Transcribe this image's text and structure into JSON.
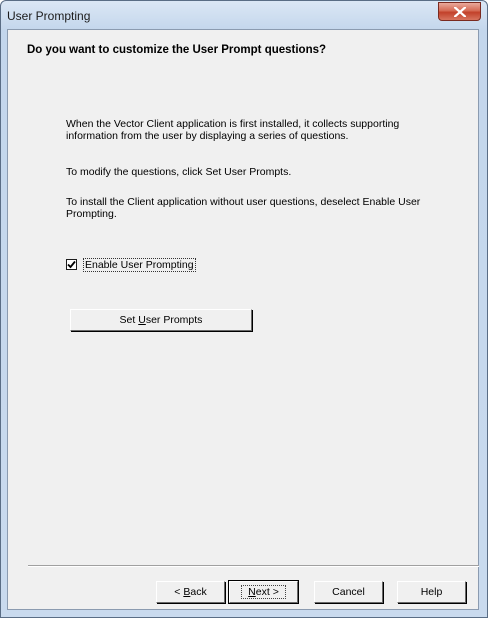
{
  "window": {
    "title": "User Prompting"
  },
  "content": {
    "heading": "Do you want to customize the User Prompt questions?",
    "paragraph1": "When the Vector Client application is first installed, it collects supporting information from the user by displaying a series of questions.",
    "paragraph2": "To modify the questions, click Set User Prompts.",
    "paragraph3": "To install the Client application without user questions, deselect Enable User Prompting.",
    "checkbox": {
      "label": "Enable User Prompting",
      "checked": true
    },
    "set_prompts_button": {
      "label_pre": "Set ",
      "label_accel": "U",
      "label_post": "ser Prompts"
    }
  },
  "footer": {
    "back_button": {
      "pre": "< ",
      "accel": "B",
      "post": "ack"
    },
    "next_button": {
      "pre": "",
      "accel": "N",
      "post": "ext >"
    },
    "cancel_label": "Cancel",
    "help_label": "Help"
  },
  "colors": {
    "title_gradient_top": "#dbe7f5",
    "close_button": "#c2412a",
    "client_bg": "#f0f0f0"
  },
  "icons": {
    "close": "close-icon",
    "check": "check-icon"
  }
}
